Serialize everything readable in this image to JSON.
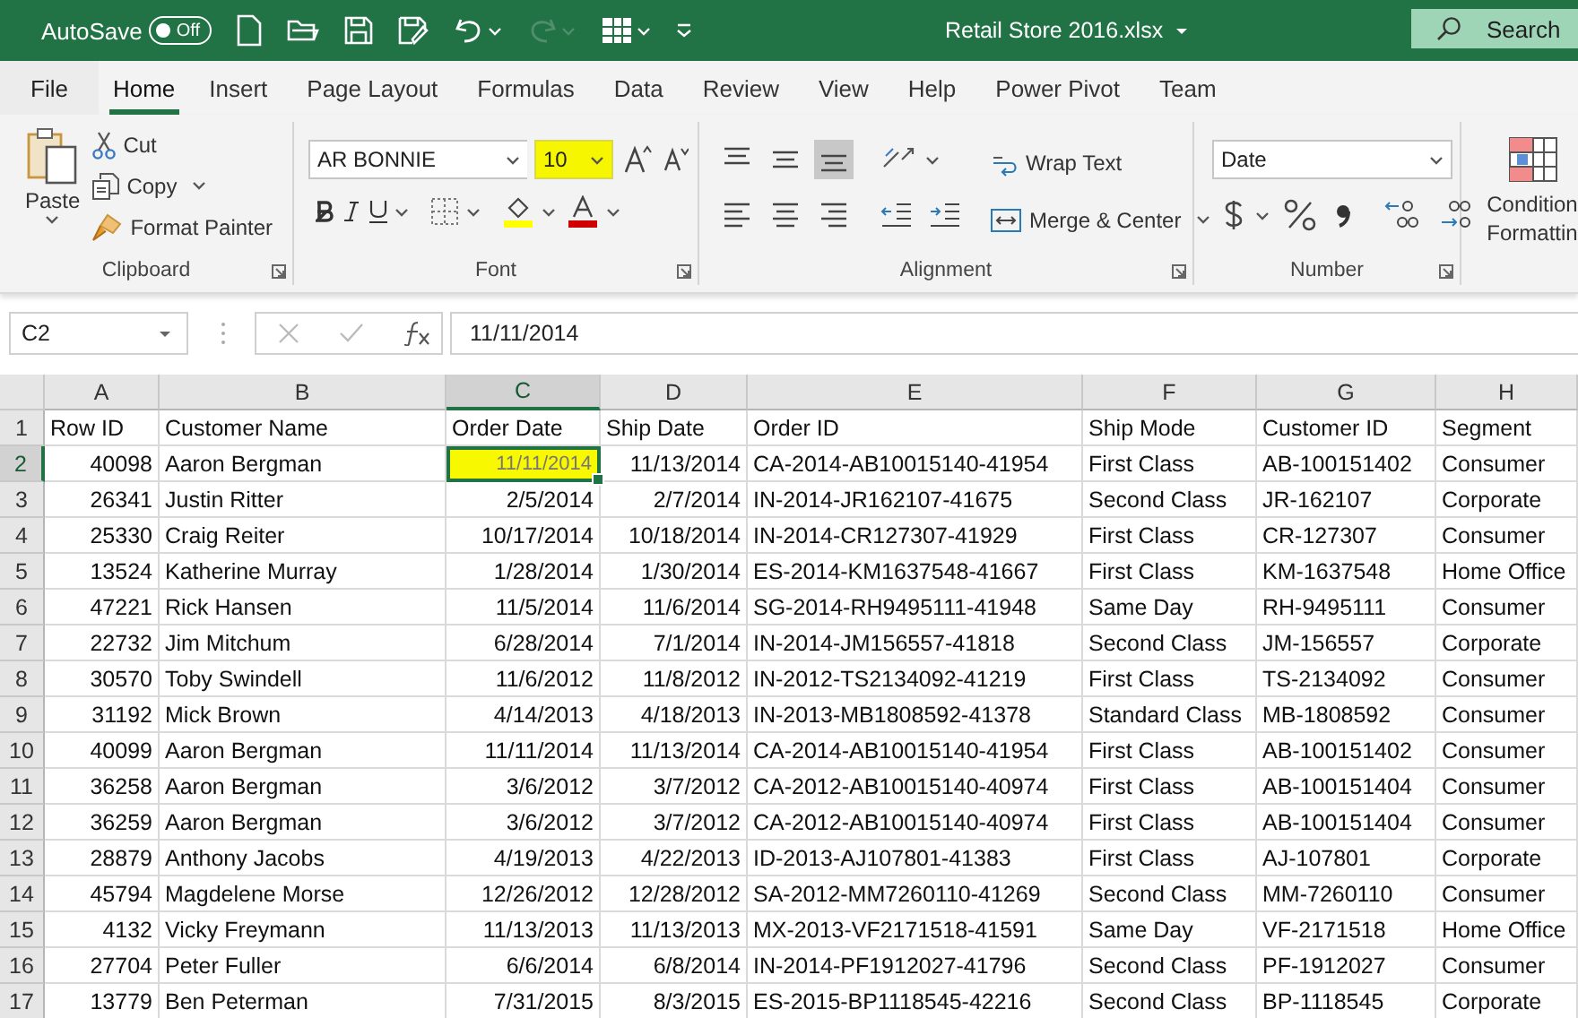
{
  "title_bar": {
    "autosave_label": "AutoSave",
    "autosave": {
      "on": false,
      "label": "Off"
    },
    "redo_disabled": true,
    "filename": "Retail Store 2016.xlsx",
    "search": {
      "placeholder": "Search"
    }
  },
  "tabs": [
    {
      "label": "File",
      "selected": false
    },
    {
      "label": "Home",
      "selected": true
    },
    {
      "label": "Insert",
      "selected": false
    },
    {
      "label": "Page Layout",
      "selected": false
    },
    {
      "label": "Formulas",
      "selected": false
    },
    {
      "label": "Data",
      "selected": false
    },
    {
      "label": "Review",
      "selected": false
    },
    {
      "label": "View",
      "selected": false
    },
    {
      "label": "Help",
      "selected": false
    },
    {
      "label": "Power Pivot",
      "selected": false
    },
    {
      "label": "Team",
      "selected": false
    }
  ],
  "ribbon": {
    "clipboard": {
      "title": "Clipboard",
      "paste": "Paste",
      "cut": "Cut",
      "copy": "Copy",
      "format_painter": "Format Painter"
    },
    "font": {
      "title": "Font",
      "name": "AR BONNIE",
      "size": "10",
      "size_highlighted": true
    },
    "alignment": {
      "title": "Alignment",
      "vertical_align": [
        {
          "selected": false
        },
        {
          "selected": false
        },
        {
          "selected": true
        }
      ],
      "wrap_text": "Wrap Text",
      "merge_center": "Merge & Center"
    },
    "number": {
      "title": "Number",
      "format": "Date"
    },
    "styles": {
      "conditional_formatting": [
        "Condition",
        "Formattin"
      ]
    }
  },
  "formula_bar": {
    "name_box": "C2",
    "value": "11/11/2014"
  },
  "grid": {
    "active_highlighted": true,
    "columns": [
      {
        "letter": "A",
        "selected": false
      },
      {
        "letter": "B",
        "selected": false
      },
      {
        "letter": "C",
        "selected": true
      },
      {
        "letter": "D",
        "selected": false
      },
      {
        "letter": "E",
        "selected": false
      },
      {
        "letter": "F",
        "selected": false
      },
      {
        "letter": "G",
        "selected": false
      },
      {
        "letter": "H",
        "selected": false
      }
    ],
    "rows": [
      {
        "number": "1",
        "selected": false,
        "kind": "header",
        "cells": [
          "Row ID",
          "Customer Name",
          "Order Date",
          "Ship Date",
          "Order ID",
          "Ship Mode",
          "Customer ID",
          "Segment"
        ]
      },
      {
        "number": "2",
        "selected": true,
        "kind": "data",
        "cells": [
          "40098",
          "Aaron Bergman",
          "11/11/2014",
          "11/13/2014",
          "CA-2014-AB10015140-41954",
          "First Class",
          "AB-100151402",
          "Consumer"
        ]
      },
      {
        "number": "3",
        "selected": false,
        "kind": "data",
        "cells": [
          "26341",
          "Justin Ritter",
          "2/5/2014",
          "2/7/2014",
          "IN-2014-JR162107-41675",
          "Second Class",
          "JR-162107",
          "Corporate"
        ]
      },
      {
        "number": "4",
        "selected": false,
        "kind": "data",
        "cells": [
          "25330",
          "Craig Reiter",
          "10/17/2014",
          "10/18/2014",
          "IN-2014-CR127307-41929",
          "First Class",
          "CR-127307",
          "Consumer"
        ]
      },
      {
        "number": "5",
        "selected": false,
        "kind": "data",
        "cells": [
          "13524",
          "Katherine Murray",
          "1/28/2014",
          "1/30/2014",
          "ES-2014-KM1637548-41667",
          "First Class",
          "KM-1637548",
          "Home Office"
        ]
      },
      {
        "number": "6",
        "selected": false,
        "kind": "data",
        "cells": [
          "47221",
          "Rick Hansen",
          "11/5/2014",
          "11/6/2014",
          "SG-2014-RH9495111-41948",
          "Same Day",
          "RH-9495111",
          "Consumer"
        ]
      },
      {
        "number": "7",
        "selected": false,
        "kind": "data",
        "cells": [
          "22732",
          "Jim Mitchum",
          "6/28/2014",
          "7/1/2014",
          "IN-2014-JM156557-41818",
          "Second Class",
          "JM-156557",
          "Corporate"
        ]
      },
      {
        "number": "8",
        "selected": false,
        "kind": "data",
        "cells": [
          "30570",
          "Toby Swindell",
          "11/6/2012",
          "11/8/2012",
          "IN-2012-TS2134092-41219",
          "First Class",
          "TS-2134092",
          "Consumer"
        ]
      },
      {
        "number": "9",
        "selected": false,
        "kind": "data",
        "cells": [
          "31192",
          "Mick Brown",
          "4/14/2013",
          "4/18/2013",
          "IN-2013-MB1808592-41378",
          "Standard Class",
          "MB-1808592",
          "Consumer"
        ]
      },
      {
        "number": "10",
        "selected": false,
        "kind": "data",
        "cells": [
          "40099",
          "Aaron Bergman",
          "11/11/2014",
          "11/13/2014",
          "CA-2014-AB10015140-41954",
          "First Class",
          "AB-100151402",
          "Consumer"
        ]
      },
      {
        "number": "11",
        "selected": false,
        "kind": "data",
        "cells": [
          "36258",
          "Aaron Bergman",
          "3/6/2012",
          "3/7/2012",
          "CA-2012-AB10015140-40974",
          "First Class",
          "AB-100151404",
          "Consumer"
        ]
      },
      {
        "number": "12",
        "selected": false,
        "kind": "data",
        "cells": [
          "36259",
          "Aaron Bergman",
          "3/6/2012",
          "3/7/2012",
          "CA-2012-AB10015140-40974",
          "First Class",
          "AB-100151404",
          "Consumer"
        ]
      },
      {
        "number": "13",
        "selected": false,
        "kind": "data",
        "cells": [
          "28879",
          "Anthony Jacobs",
          "4/19/2013",
          "4/22/2013",
          "ID-2013-AJ107801-41383",
          "First Class",
          "AJ-107801",
          "Corporate"
        ]
      },
      {
        "number": "14",
        "selected": false,
        "kind": "data",
        "cells": [
          "45794",
          "Magdelene Morse",
          "12/26/2012",
          "12/28/2012",
          "SA-2012-MM7260110-41269",
          "Second Class",
          "MM-7260110",
          "Consumer"
        ]
      },
      {
        "number": "15",
        "selected": false,
        "kind": "data",
        "cells": [
          "4132",
          "Vicky Freymann",
          "11/13/2013",
          "11/13/2013",
          "MX-2013-VF2171518-41591",
          "Same Day",
          "VF-2171518",
          "Home Office"
        ]
      },
      {
        "number": "16",
        "selected": false,
        "kind": "data",
        "cells": [
          "27704",
          "Peter Fuller",
          "6/6/2014",
          "6/8/2014",
          "IN-2014-PF1912027-41796",
          "Second Class",
          "PF-1912027",
          "Consumer"
        ]
      },
      {
        "number": "17",
        "selected": false,
        "kind": "data",
        "cells": [
          "13779",
          "Ben Peterman",
          "7/31/2015",
          "8/3/2015",
          "ES-2015-BP1118545-42216",
          "Second Class",
          "BP-1118545",
          "Corporate"
        ]
      }
    ]
  }
}
